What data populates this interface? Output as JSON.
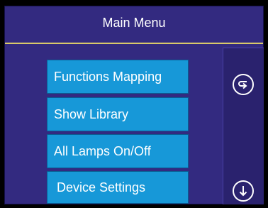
{
  "header": {
    "title": "Main Menu"
  },
  "menu": {
    "items": [
      {
        "label": "Functions Mapping"
      },
      {
        "label": "Show Library"
      },
      {
        "label": "All Lamps On/Off"
      },
      {
        "label": "Device Settings"
      }
    ]
  },
  "side_panel": {
    "buttons": [
      {
        "icon": "back-arrow-icon"
      },
      {
        "icon": "down-arrow-icon"
      }
    ]
  },
  "colors": {
    "background": "#332a80",
    "button": "#1798d8",
    "title_rule": "#d9c96a",
    "text": "#ffffff"
  }
}
